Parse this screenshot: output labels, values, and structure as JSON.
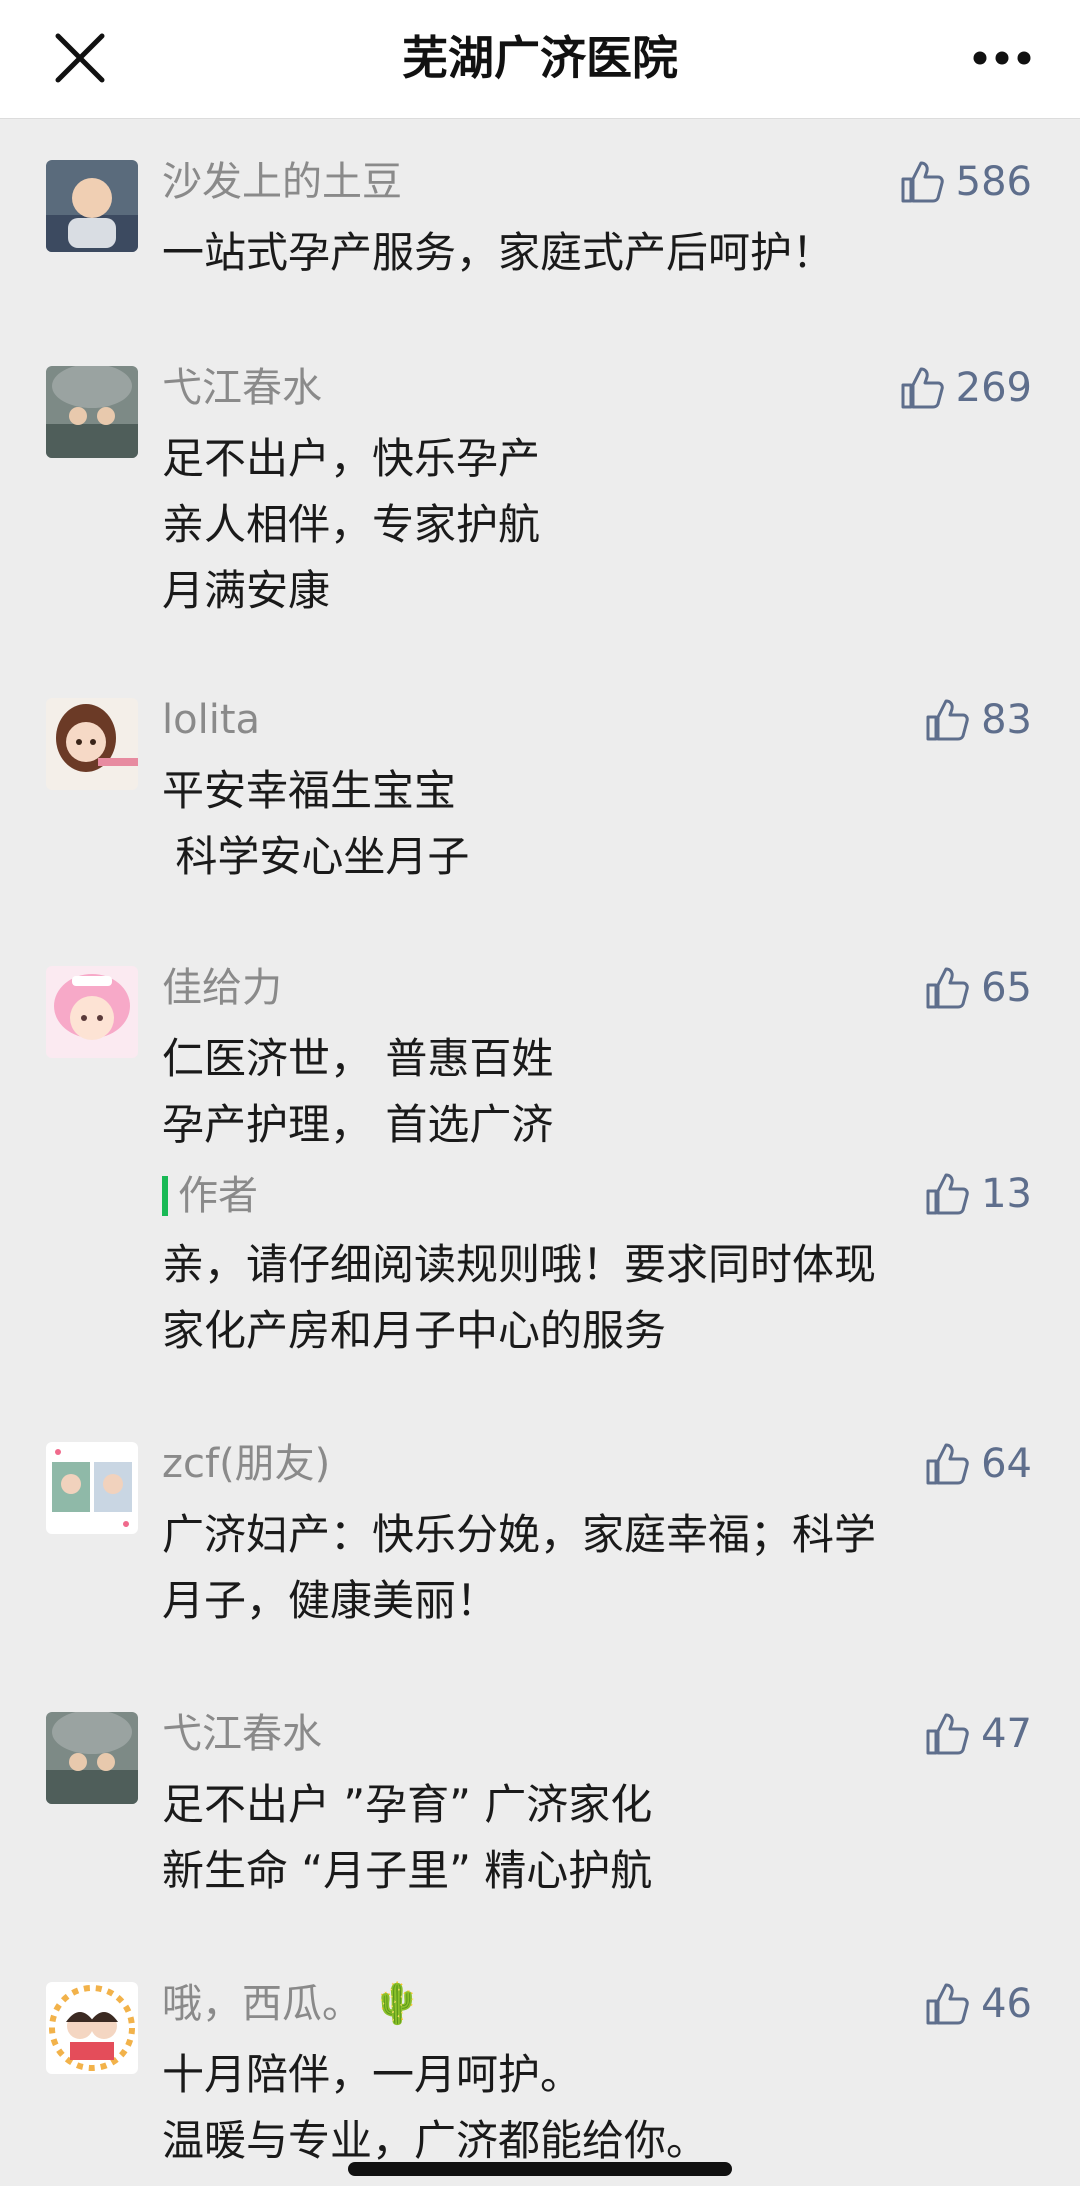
{
  "header": {
    "title": "芜湖广济医院"
  },
  "comments": [
    {
      "name": "沙发上的土豆",
      "likes": "586",
      "text": "一站式孕产服务，家庭式产后呵护！"
    },
    {
      "name": "弋江春水",
      "likes": "269",
      "text": "足不出户，快乐孕产\n亲人相伴，专家护航\n月满安康"
    },
    {
      "name": "lolita",
      "likes": "83",
      "text": "平安幸福生宝宝\n 科学安心坐月子"
    },
    {
      "name": "佳给力",
      "likes": "65",
      "text": "仁医济世， 普惠百姓\n孕产护理， 首选广济"
    },
    {
      "name": "zcf(朋友)",
      "likes": "64",
      "text": "广济妇产：快乐分娩，家庭幸福；科学\n月子，健康美丽！"
    },
    {
      "name": "弋江春水",
      "likes": "47",
      "text": "足不出户 ”孕育” 广济家化\n新生命 “月子里” 精心护航"
    },
    {
      "name": "哦，西瓜。",
      "likes": "46",
      "text": "十月陪伴，一月呵护。\n温暖与专业，广济都能给你。",
      "emoji": "🌵"
    }
  ],
  "author_reply": {
    "label": "作者",
    "likes": "13",
    "text": "亲，请仔细阅读规则哦！要求同时体现\n家化产房和月子中心的服务"
  },
  "colors": {
    "accent_green": "#19b955",
    "like_blue": "#5e6e8c"
  }
}
